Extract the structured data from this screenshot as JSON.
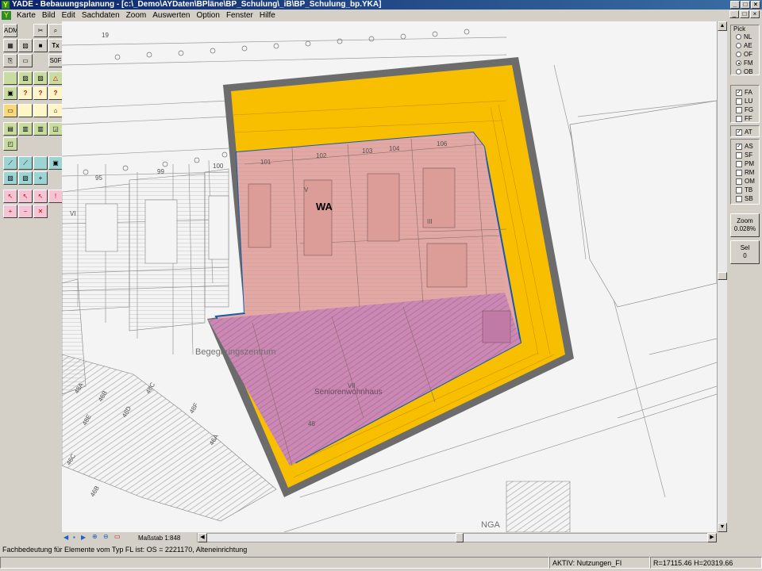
{
  "window": {
    "title": "YADE - Bebauungsplanung - [c:\\_Demo\\AYDaten\\BPläne\\BP_Schulung\\_iB\\BP_Schulung_bp.YKA]"
  },
  "menu": [
    "Karte",
    "Bild",
    "Edit",
    "Sachdaten",
    "Zoom",
    "Auswerten",
    "Option",
    "Fenster",
    "Hilfe"
  ],
  "toolbar": {
    "row1": [
      "ADM",
      "✂",
      "🔍"
    ],
    "row2": [
      "▨",
      "▣",
      "Tx"
    ],
    "row3": [
      "⎗",
      "⌗",
      "50F"
    ]
  },
  "map": {
    "labels": {
      "wa": "WA",
      "begegnung": "Begegnungszentrum",
      "senioren": "Seniorenwohnhaus",
      "nga": "NGA",
      "p101": "101",
      "p102": "102",
      "p103": "103",
      "p104": "104",
      "p106": "106",
      "p19": "19",
      "p95": "95",
      "p99": "99",
      "p100": "100",
      "s48a": "48A",
      "s48b": "48B",
      "s48c": "48C",
      "s48d": "48D",
      "s48e": "48E",
      "s48f": "48F",
      "s46a": "46A",
      "s46b": "46B",
      "s46c": "46C",
      "s48": "48",
      "v": "V",
      "vi": "VI",
      "vii": "VII",
      "iii": "III"
    }
  },
  "bottom": {
    "scale": "Maßstab 1:848"
  },
  "pick": {
    "title": "Pick",
    "radios": [
      {
        "label": "NL",
        "selected": false
      },
      {
        "label": "AE",
        "selected": false
      },
      {
        "label": "OF",
        "selected": false
      },
      {
        "label": "FM",
        "selected": true
      },
      {
        "label": "OB",
        "selected": false
      }
    ],
    "checks1": [
      {
        "label": "FA",
        "checked": true
      },
      {
        "label": "LU",
        "checked": false
      },
      {
        "label": "FG",
        "checked": false
      },
      {
        "label": "FF",
        "checked": false
      }
    ],
    "checks2": [
      {
        "label": "AT",
        "checked": true
      }
    ],
    "checks3": [
      {
        "label": "AS",
        "checked": true
      },
      {
        "label": "SF",
        "checked": false
      },
      {
        "label": "PM",
        "checked": false
      },
      {
        "label": "RM",
        "checked": false
      },
      {
        "label": "OM",
        "checked": false
      },
      {
        "label": "TB",
        "checked": false
      },
      {
        "label": "SB",
        "checked": false
      }
    ]
  },
  "zoom": {
    "label": "Zoom",
    "value": "0.028%"
  },
  "sel": {
    "label": "Sel",
    "value": "0"
  },
  "status": {
    "message": "Fachbedeutung für Elemente vom Typ FL ist: OS = 2221170, Alteneinrichtung",
    "active": "AKTIV: Nutzungen_FI",
    "coords": "R=17115.46 H=20319.66"
  },
  "colors": {
    "orange": "#f8bf00",
    "wa": "#e4a8a4",
    "senior": "#cc88b4",
    "border": "#6c6c6c",
    "blueline": "#1a5aa8"
  }
}
